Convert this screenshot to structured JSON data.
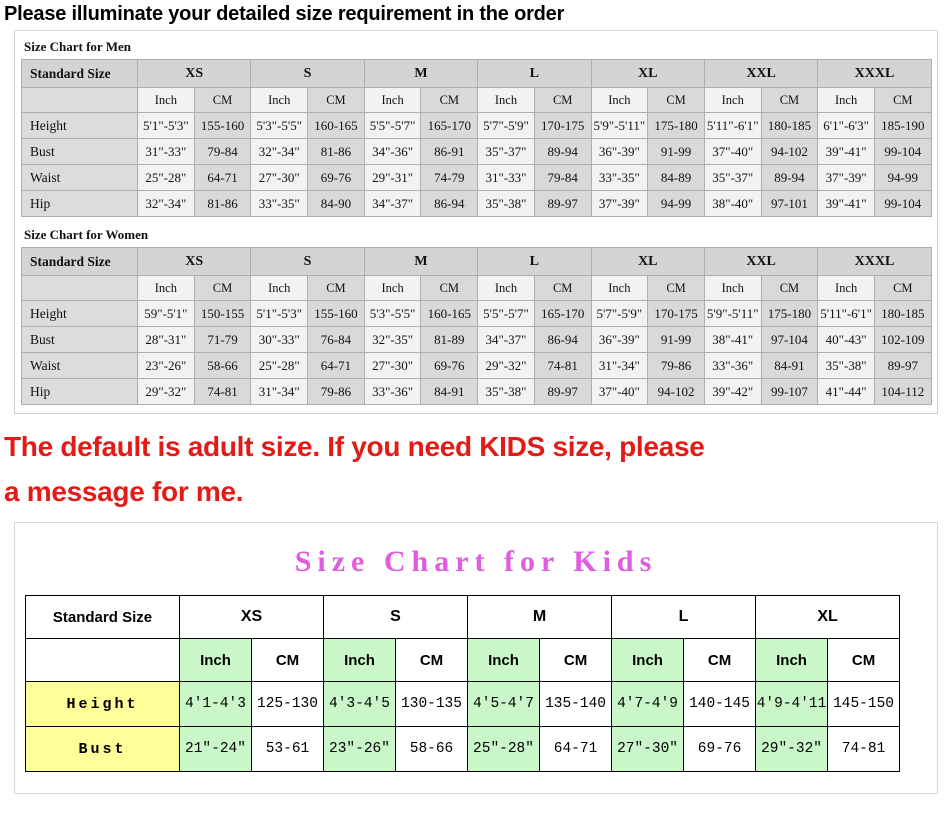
{
  "heading": "Please illuminate your detailed size requirement in the order",
  "adult": {
    "men": {
      "caption": "Size Chart for Men",
      "std_size_label": "Standard Size",
      "sizes": [
        "XS",
        "S",
        "M",
        "L",
        "XL",
        "XXL",
        "XXXL"
      ],
      "units": [
        "Inch",
        "CM"
      ],
      "rows": [
        {
          "label": "Height",
          "values": [
            "5'1\"-5'3\"",
            "155-160",
            "5'3\"-5'5\"",
            "160-165",
            "5'5\"-5'7\"",
            "165-170",
            "5'7\"-5'9\"",
            "170-175",
            "5'9\"-5'11\"",
            "175-180",
            "5'11\"-6'1\"",
            "180-185",
            "6'1\"-6'3\"",
            "185-190"
          ]
        },
        {
          "label": "Bust",
          "values": [
            "31\"-33\"",
            "79-84",
            "32\"-34\"",
            "81-86",
            "34\"-36\"",
            "86-91",
            "35\"-37\"",
            "89-94",
            "36\"-39\"",
            "91-99",
            "37\"-40\"",
            "94-102",
            "39\"-41\"",
            "99-104"
          ]
        },
        {
          "label": "Waist",
          "values": [
            "25\"-28\"",
            "64-71",
            "27\"-30\"",
            "69-76",
            "29\"-31\"",
            "74-79",
            "31\"-33\"",
            "79-84",
            "33\"-35\"",
            "84-89",
            "35\"-37\"",
            "89-94",
            "37\"-39\"",
            "94-99"
          ]
        },
        {
          "label": "Hip",
          "values": [
            "32\"-34\"",
            "81-86",
            "33\"-35\"",
            "84-90",
            "34\"-37\"",
            "86-94",
            "35\"-38\"",
            "89-97",
            "37\"-39\"",
            "94-99",
            "38\"-40\"",
            "97-101",
            "39\"-41\"",
            "99-104"
          ]
        }
      ]
    },
    "women": {
      "caption": "Size Chart for Women",
      "std_size_label": "Standard Size",
      "sizes": [
        "XS",
        "S",
        "M",
        "L",
        "XL",
        "XXL",
        "XXXL"
      ],
      "units": [
        "Inch",
        "CM"
      ],
      "rows": [
        {
          "label": "Height",
          "values": [
            "59\"-5'1\"",
            "150-155",
            "5'1\"-5'3\"",
            "155-160",
            "5'3\"-5'5\"",
            "160-165",
            "5'5\"-5'7\"",
            "165-170",
            "5'7\"-5'9\"",
            "170-175",
            "5'9\"-5'11\"",
            "175-180",
            "5'11\"-6'1\"",
            "180-185"
          ]
        },
        {
          "label": "Bust",
          "values": [
            "28\"-31\"",
            "71-79",
            "30\"-33\"",
            "76-84",
            "32\"-35\"",
            "81-89",
            "34\"-37\"",
            "86-94",
            "36\"-39\"",
            "91-99",
            "38\"-41\"",
            "97-104",
            "40\"-43\"",
            "102-109"
          ]
        },
        {
          "label": "Waist",
          "values": [
            "23\"-26\"",
            "58-66",
            "25\"-28\"",
            "64-71",
            "27\"-30\"",
            "69-76",
            "29\"-32\"",
            "74-81",
            "31\"-34\"",
            "79-86",
            "33\"-36\"",
            "84-91",
            "35\"-38\"",
            "89-97"
          ]
        },
        {
          "label": "Hip",
          "values": [
            "29\"-32\"",
            "74-81",
            "31\"-34\"",
            "79-86",
            "33\"-36\"",
            "84-91",
            "35\"-38\"",
            "89-97",
            "37\"-40\"",
            "94-102",
            "39\"-42\"",
            "99-107",
            "41\"-44\"",
            "104-112"
          ]
        }
      ]
    }
  },
  "notice": {
    "line1": "The default is adult size. If you need KIDS size, please",
    "line2": "a message for me."
  },
  "kids": {
    "title": "Size Chart for Kids",
    "std_size_label": "Standard Size",
    "sizes": [
      "XS",
      "S",
      "M",
      "L",
      "XL"
    ],
    "units": [
      "Inch",
      "CM"
    ],
    "rows": [
      {
        "label": "Height",
        "values": [
          "4'1-4'3",
          "125-130",
          "4'3-4'5",
          "130-135",
          "4'5-4'7",
          "135-140",
          "4'7-4'9",
          "140-145",
          "4'9-4'11",
          "145-150"
        ]
      },
      {
        "label": "Bust",
        "values": [
          "21″-24″",
          "53-61",
          "23″-26″",
          "58-66",
          "25″-28″",
          "64-71",
          "27″-30″",
          "69-76",
          "29″-32″",
          "74-81"
        ]
      }
    ]
  },
  "colors": {
    "notice_red": "#e31b16",
    "kids_title_pink": "#e05ce0",
    "kids_inch_green": "#c9f7c9",
    "kids_label_yellow": "#ffff99",
    "adult_header_grey": "#d4d4d4"
  }
}
